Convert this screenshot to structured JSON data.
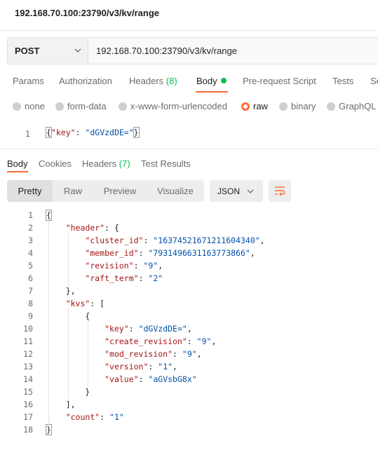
{
  "window": {
    "title": "192.168.70.100:23790/v3/kv/range"
  },
  "request": {
    "method": "POST",
    "url": "192.168.70.100:23790/v3/kv/range"
  },
  "request_tabs": [
    {
      "label": "Params"
    },
    {
      "label": "Authorization"
    },
    {
      "label": "Headers",
      "count": "(8)"
    },
    {
      "label": "Body",
      "active": true
    },
    {
      "label": "Pre-request Script"
    },
    {
      "label": "Tests"
    },
    {
      "label": "Se"
    }
  ],
  "body_types": [
    {
      "label": "none"
    },
    {
      "label": "form-data"
    },
    {
      "label": "x-www-form-urlencoded"
    },
    {
      "label": "raw",
      "selected": true
    },
    {
      "label": "binary"
    },
    {
      "label": "GraphQL"
    }
  ],
  "request_body": {
    "line_number": "1",
    "open": "{",
    "key": "\"key\"",
    "sep": ": ",
    "value": "\"dGVzdDE=\"",
    "close": "}"
  },
  "response_tabs": [
    {
      "label": "Body",
      "active": true
    },
    {
      "label": "Cookies"
    },
    {
      "label": "Headers",
      "count": "(7)"
    },
    {
      "label": "Test Results"
    }
  ],
  "view_modes": [
    "Pretty",
    "Raw",
    "Preview",
    "Visualize"
  ],
  "format": "JSON",
  "response_lines": [
    {
      "n": "1",
      "p": [
        [
          "",
          "{"
        ]
      ]
    },
    {
      "n": "2",
      "p": [
        [
          "",
          "    "
        ],
        [
          "key",
          "\"header\""
        ],
        [
          "",
          ": {"
        ]
      ]
    },
    {
      "n": "3",
      "p": [
        [
          "",
          "        "
        ],
        [
          "key",
          "\"cluster_id\""
        ],
        [
          "",
          ": "
        ],
        [
          "str",
          "\"16374521671211604340\""
        ],
        [
          "",
          ","
        ]
      ]
    },
    {
      "n": "4",
      "p": [
        [
          "",
          "        "
        ],
        [
          "key",
          "\"member_id\""
        ],
        [
          "",
          ": "
        ],
        [
          "str",
          "\"7931496631163773866\""
        ],
        [
          "",
          ","
        ]
      ]
    },
    {
      "n": "5",
      "p": [
        [
          "",
          "        "
        ],
        [
          "key",
          "\"revision\""
        ],
        [
          "",
          ": "
        ],
        [
          "str",
          "\"9\""
        ],
        [
          "",
          ","
        ]
      ]
    },
    {
      "n": "6",
      "p": [
        [
          "",
          "        "
        ],
        [
          "key",
          "\"raft_term\""
        ],
        [
          "",
          ": "
        ],
        [
          "str",
          "\"2\""
        ]
      ]
    },
    {
      "n": "7",
      "p": [
        [
          "",
          "    },"
        ]
      ]
    },
    {
      "n": "8",
      "p": [
        [
          "",
          "    "
        ],
        [
          "key",
          "\"kvs\""
        ],
        [
          "",
          ": ["
        ]
      ]
    },
    {
      "n": "9",
      "p": [
        [
          "",
          "        {"
        ]
      ]
    },
    {
      "n": "10",
      "p": [
        [
          "",
          "            "
        ],
        [
          "key",
          "\"key\""
        ],
        [
          "",
          ": "
        ],
        [
          "str",
          "\"dGVzdDE=\""
        ],
        [
          "",
          ","
        ]
      ]
    },
    {
      "n": "11",
      "p": [
        [
          "",
          "            "
        ],
        [
          "key",
          "\"create_revision\""
        ],
        [
          "",
          ": "
        ],
        [
          "str",
          "\"9\""
        ],
        [
          "",
          ","
        ]
      ]
    },
    {
      "n": "12",
      "p": [
        [
          "",
          "            "
        ],
        [
          "key",
          "\"mod_revision\""
        ],
        [
          "",
          ": "
        ],
        [
          "str",
          "\"9\""
        ],
        [
          "",
          ","
        ]
      ]
    },
    {
      "n": "13",
      "p": [
        [
          "",
          "            "
        ],
        [
          "key",
          "\"version\""
        ],
        [
          "",
          ": "
        ],
        [
          "str",
          "\"1\""
        ],
        [
          "",
          ","
        ]
      ]
    },
    {
      "n": "14",
      "p": [
        [
          "",
          "            "
        ],
        [
          "key",
          "\"value\""
        ],
        [
          "",
          ": "
        ],
        [
          "str",
          "\"aGVsbG8x\""
        ]
      ]
    },
    {
      "n": "15",
      "p": [
        [
          "",
          "        }"
        ]
      ]
    },
    {
      "n": "16",
      "p": [
        [
          "",
          "    ],"
        ]
      ]
    },
    {
      "n": "17",
      "p": [
        [
          "",
          "    "
        ],
        [
          "key",
          "\"count\""
        ],
        [
          "",
          ": "
        ],
        [
          "str",
          "\"1\""
        ]
      ]
    },
    {
      "n": "18",
      "p": [
        [
          "",
          "}"
        ]
      ]
    }
  ]
}
